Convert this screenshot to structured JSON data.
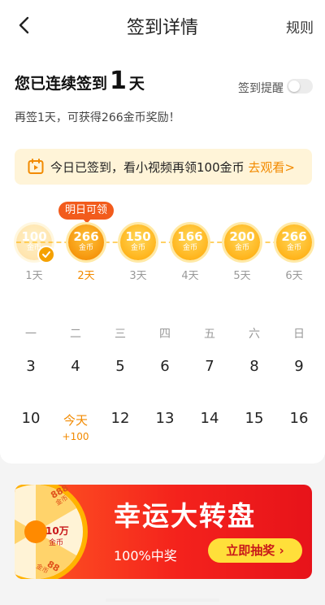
{
  "nav": {
    "title": "签到详情",
    "rules_label": "规则"
  },
  "streak": {
    "prefix": "您已连续签到",
    "count": "1",
    "suffix": "天"
  },
  "reminder": {
    "label": "签到提醒",
    "enabled": false
  },
  "hint": "再签1天，可获得266金币奖励！",
  "banner": {
    "text": "今日已签到，看小视频再领100金币",
    "link": "去观看>"
  },
  "rewards": {
    "tomorrow_tag": "明日可领",
    "unit": "金币",
    "items": [
      {
        "value": "100",
        "day": "1天",
        "state": "done"
      },
      {
        "value": "266",
        "day": "2天",
        "state": "next"
      },
      {
        "value": "150",
        "day": "3天",
        "state": "future"
      },
      {
        "value": "166",
        "day": "4天",
        "state": "future"
      },
      {
        "value": "200",
        "day": "5天",
        "state": "future"
      },
      {
        "value": "266",
        "day": "6天",
        "state": "future"
      }
    ]
  },
  "calendar": {
    "weekdays": [
      "一",
      "二",
      "三",
      "四",
      "五",
      "六",
      "日"
    ],
    "week1": [
      "3",
      "4",
      "5",
      "6",
      "7",
      "8",
      "9"
    ],
    "week2": [
      "10",
      "今天",
      "12",
      "13",
      "14",
      "15",
      "16"
    ],
    "today_bonus": "+100"
  },
  "promo": {
    "title": "幸运大转盘",
    "subtitle": "100%中奖",
    "button": "立即抽奖 ›",
    "wheel_labels": [
      "888",
      "金币",
      "10万",
      "金币",
      "88",
      "金币"
    ]
  },
  "colors": {
    "accent": "#f28a00",
    "tag": "#f25b1c",
    "promo": "#f4221c",
    "banner_bg": "#fff4d8"
  }
}
